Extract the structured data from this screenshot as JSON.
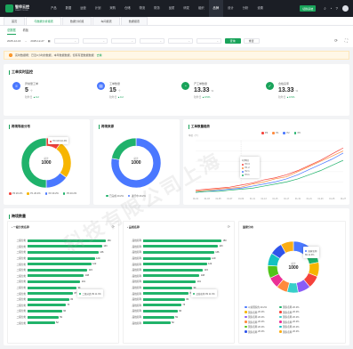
{
  "brand": {
    "name": "智伴云控",
    "sub": "SMART CLOUD"
  },
  "nav": [
    "产品",
    "数据",
    "运营",
    "计划",
    "采购",
    "仓储",
    "物流",
    "财务",
    "品质",
    "研发",
    "组织",
    "品牌",
    "设计",
    "分析",
    "设置"
  ],
  "nav_active": 11,
  "top_button": "切换系统",
  "tabs": [
    "首页",
    "与数据分析报表",
    "数据分析报",
    "车间报表",
    "数据报表"
  ],
  "tab_active": 1,
  "subtabs": [
    "总数据",
    "看板"
  ],
  "filter": {
    "date_start": "2025-12-16",
    "date_end": "2025-12-27",
    "selects": [
      "",
      "",
      "",
      "",
      "",
      "",
      "",
      ""
    ],
    "query": "查询",
    "reset": "重置"
  },
  "alert": {
    "text": "实时数据概：已近3小时的数据，本年数据数据，但有有更数据数据",
    "link": "去看"
  },
  "overview": {
    "title": "工单实时监控",
    "stats": [
      {
        "label": "异常量工单",
        "value": "5",
        "unit": "个",
        "cmp": "较昨日",
        "delta": "0.2",
        "color": "#4a78ff",
        "icon": "≡"
      },
      {
        "label": "工单数量",
        "value": "15",
        "unit": "个",
        "cmp": "较昨日",
        "delta": "0.2",
        "color": "#4a78ff",
        "icon": "▤"
      },
      {
        "label": "产工单数量",
        "value": "13.33",
        "unit": "%",
        "cmp": "较昨日",
        "delta": "0.5%",
        "color": "#19a35a",
        "icon": "◔"
      },
      {
        "label": "合格良率",
        "value": "13.33",
        "unit": "%",
        "cmp": "较昨日",
        "delta": "0.5%",
        "color": "#19a35a",
        "icon": "✓"
      }
    ]
  },
  "panel1": {
    "title": "跨境等级分布",
    "center_label": "总计",
    "center_value": "1000",
    "legend": [
      "P0",
      "P1",
      "P2",
      "P3"
    ],
    "pcts": [
      "20.2%",
      "20.2%",
      "20.2%",
      "20.2%"
    ],
    "tip": {
      "name": "P0",
      "value": "103",
      "pct": "10.3%"
    }
  },
  "panel2": {
    "title": "跨境来源",
    "center_label": "总计",
    "center_value": "1000",
    "legend": [
      "已完成",
      "20.2%",
      "进行中",
      "20.2%"
    ]
  },
  "panel3": {
    "title": "工单数量趋势",
    "ylabel": "单位（个）",
    "legend": [
      "P0",
      "P1",
      "P2",
      "P3"
    ],
    "x": [
      "01",
      "02",
      "03",
      "04",
      "05",
      "06",
      "07",
      "08",
      "09",
      "10",
      "11",
      "12",
      "13",
      "14",
      "15",
      "16",
      "17",
      "18",
      "19",
      "20",
      "21",
      "22",
      "23",
      "24",
      "25",
      "26",
      "27"
    ],
    "x_labels": [
      "01-01",
      "01-03",
      "01-05",
      "01-07",
      "01-09",
      "01-11",
      "01-13",
      "01-15",
      "01-17",
      "01-19",
      "01-21",
      "01-23",
      "01-25",
      "01-27"
    ],
    "tip": {
      "title": "1月8日",
      "rows": [
        {
          "name": "P0",
          "value": "3"
        },
        {
          "name": "P1",
          "value": "2"
        },
        {
          "name": "P2",
          "value": "1"
        },
        {
          "name": "P3",
          "value": "1"
        }
      ]
    }
  },
  "chart_data": [
    {
      "type": "pie",
      "title": "跨境等级分布",
      "labels": [
        "P0",
        "P1",
        "P2",
        "P3"
      ],
      "values": [
        10,
        25,
        15,
        50
      ],
      "colors": [
        "#f5423b",
        "#f7b500",
        "#4a78ff",
        "#1fb26b"
      ]
    },
    {
      "type": "pie",
      "title": "跨境来源",
      "labels": [
        "已完成",
        "进行中"
      ],
      "values": [
        78,
        22
      ],
      "colors": [
        "#4a78ff",
        "#1fb26b"
      ]
    },
    {
      "type": "line",
      "title": "工单数量趋势",
      "x": [
        "01-01",
        "01-03",
        "01-05",
        "01-07",
        "01-09",
        "01-11",
        "01-13",
        "01-15",
        "01-17",
        "01-19",
        "01-21",
        "01-23",
        "01-25",
        "01-27"
      ],
      "ylim": [
        0,
        50
      ],
      "series": [
        {
          "name": "P0",
          "color": "#f5423b",
          "values": [
            2,
            3,
            4,
            5,
            7,
            9,
            12,
            14,
            17,
            21,
            26,
            31,
            37,
            43
          ]
        },
        {
          "name": "P1",
          "color": "#ff8a3d",
          "values": [
            1,
            2,
            3,
            4,
            5,
            8,
            10,
            13,
            15,
            20,
            25,
            30,
            35,
            40
          ]
        },
        {
          "name": "P2",
          "color": "#4a78ff",
          "values": [
            0,
            1,
            2,
            3,
            4,
            6,
            8,
            10,
            13,
            17,
            22,
            27,
            32,
            38
          ]
        },
        {
          "name": "P3",
          "color": "#1fb26b",
          "values": [
            0,
            1,
            1,
            2,
            3,
            4,
            6,
            8,
            10,
            13,
            17,
            21,
            26,
            31
          ]
        }
      ]
    },
    {
      "type": "bar",
      "title": "一级分类名称",
      "categories": [
        "二级分类",
        "二级分类",
        "二级分类",
        "二级分类",
        "二级分类",
        "二级分类",
        "二级分类",
        "二级分类",
        "二级分类",
        "二级分类",
        "二级分类",
        "二级分类",
        "二级分类",
        "二级分类",
        "二级分类"
      ],
      "values": [
        150,
        143,
        136,
        129,
        122,
        115,
        108,
        101,
        94,
        87,
        80,
        73,
        66,
        59,
        52
      ]
    },
    {
      "type": "bar",
      "title": "品线名称",
      "categories": [
        "品线名称",
        "品线名称",
        "品线名称",
        "品线名称",
        "品线名称",
        "品线名称",
        "品线名称",
        "品线名称",
        "品线名称",
        "品线名称",
        "品线名称",
        "品线名称",
        "品线名称",
        "品线名称",
        "品线名称"
      ],
      "values": [
        150,
        143,
        136,
        129,
        122,
        115,
        108,
        101,
        94,
        87,
        80,
        73,
        66,
        59,
        52
      ]
    },
    {
      "type": "pie",
      "title": "国家分布",
      "labels": [
        "以前国家的",
        "国家名称",
        "国家名称",
        "国家名称",
        "国家名称",
        "国家名称",
        "国家名称",
        "国家名称",
        "国家名称",
        "国家名称",
        "国家名称",
        "国家名称"
      ],
      "values": [
        12,
        10,
        9,
        8,
        8,
        7,
        7,
        7,
        8,
        8,
        8,
        8
      ],
      "colors": [
        "#4a78ff",
        "#1fb26b",
        "#f7b500",
        "#f5423b",
        "#8a5cf6",
        "#36cfc9",
        "#ff8a3d",
        "#eb2f96",
        "#52c41a",
        "#13c2c2",
        "#2f54eb",
        "#faad14"
      ]
    }
  ],
  "bar_panel": {
    "title": "跨境数量",
    "left_title": "一级分类名称",
    "mid_title": "品线名称",
    "right_title": "国家分布",
    "tip_label": "二级分类",
    "tip_value": "89",
    "tip_pct": "11.3%",
    "mid_tip_label": "品线名称",
    "mid_tip_value": "89",
    "mid_tip_pct": "11.3%"
  },
  "country": {
    "center_label": "总计",
    "center_value": "1000",
    "tip_name": "国家名称",
    "tip_value": "89",
    "tip_pct": "11.3%",
    "legend_pct": "20.2%"
  },
  "watermark": "科技有限公司上海"
}
